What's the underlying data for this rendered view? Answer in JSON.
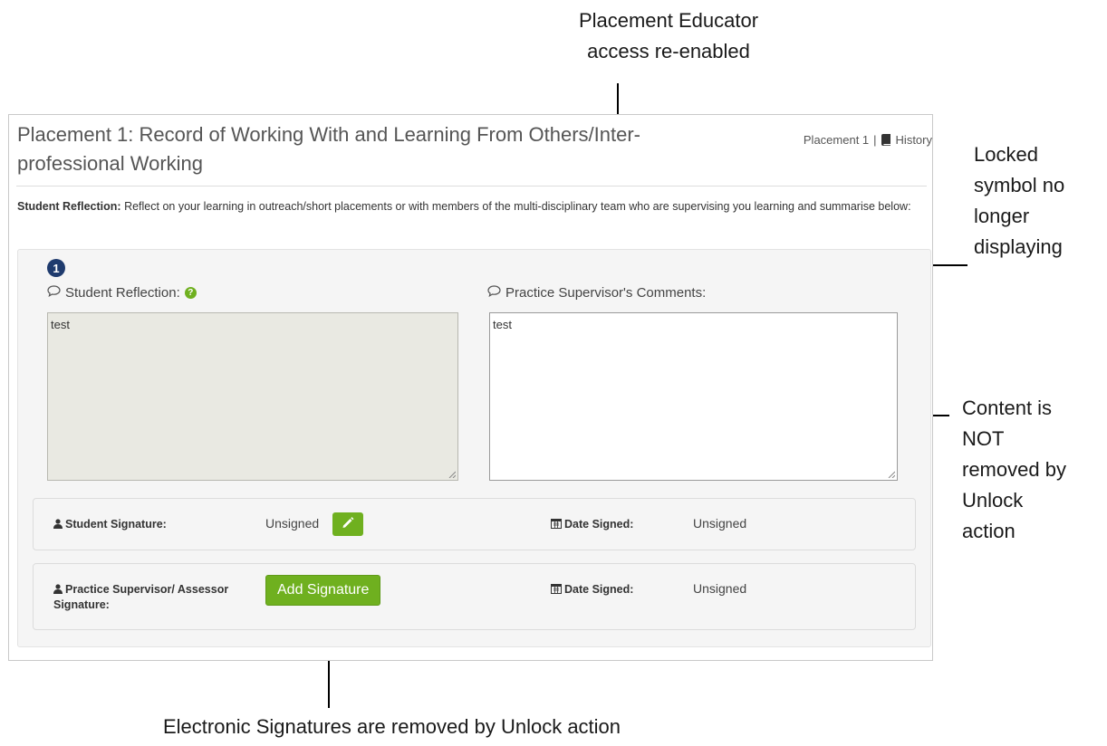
{
  "annotations": {
    "placement_educator": "Placement Educator\naccess re-enabled",
    "locked_symbol": "Locked\nsymbol no\nlonger\ndisplaying",
    "content_not_removed": "Content is\nNOT\nremoved by\nUnlock\naction",
    "signatures_removed": "Electronic Signatures are removed by Unlock action"
  },
  "panel": {
    "title": "Placement 1: Record of Working With and Learning From Others/Inter-professional Working",
    "placement_link": "Placement 1",
    "separator": "|",
    "history_link": "History",
    "instruction_label": "Student Reflection:",
    "instruction_text": "Reflect on your learning in outreach/short placements or with members of the multi-disciplinary team who are supervising you learning and summarise below:"
  },
  "section": {
    "step_number": "1",
    "student_reflection_label": "Student Reflection:",
    "student_reflection_value": "test",
    "supervisor_comments_label": "Practice Supervisor's Comments:",
    "supervisor_comments_value": "test"
  },
  "signatures": {
    "student_label": "Student Signature:",
    "student_value": "Unsigned",
    "student_date_label": "Date Signed:",
    "student_date_value": "Unsigned",
    "supervisor_label": "Practice Supervisor/ Assessor Signature:",
    "add_signature_button": "Add Signature",
    "supervisor_date_label": "Date Signed:",
    "supervisor_date_value": "Unsigned"
  },
  "colors": {
    "accent_green": "#6fb01f",
    "badge_navy": "#1f3b6e",
    "locked_field_bg": "#e9e9e2"
  },
  "icons": [
    "book-icon",
    "comment-icon",
    "question-icon",
    "user-icon",
    "pencil-icon",
    "calendar-icon"
  ]
}
